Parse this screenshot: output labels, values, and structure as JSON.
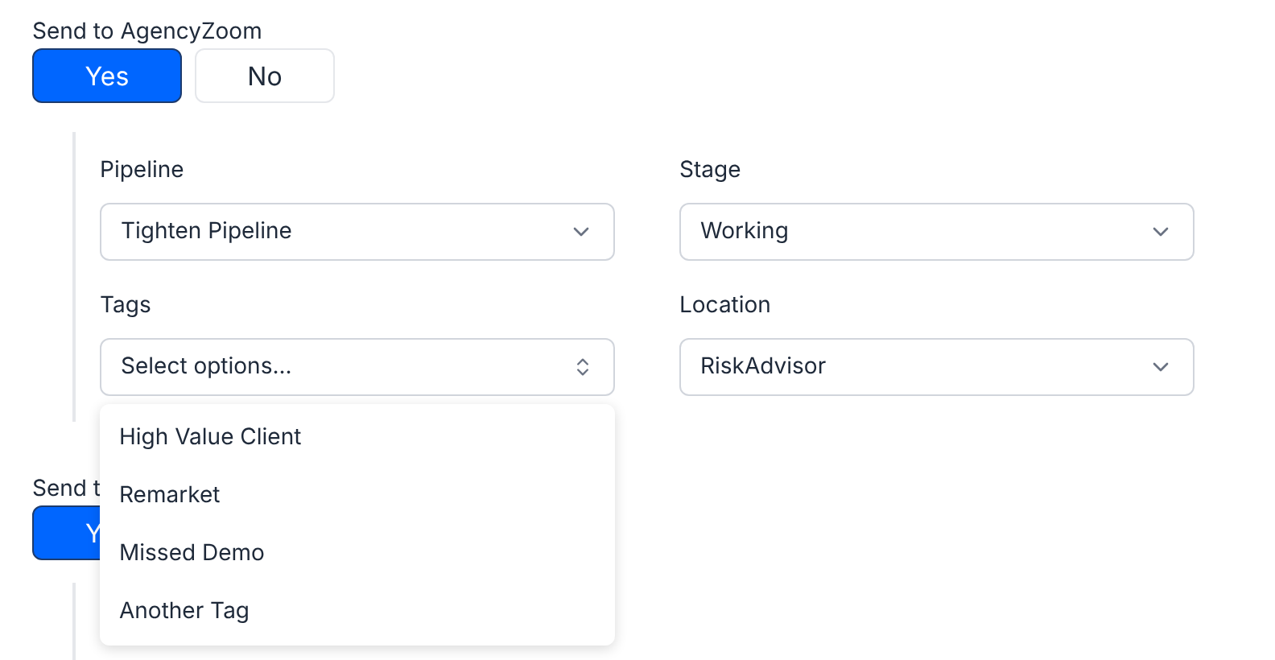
{
  "sections": [
    {
      "label": "Send to AgencyZoom",
      "options": [
        {
          "label": "Yes",
          "selected": true
        },
        {
          "label": "No",
          "selected": false
        }
      ],
      "fields": [
        {
          "kind": "select",
          "label": "Pipeline",
          "value": "Tighten Pipeline"
        },
        {
          "kind": "select",
          "label": "Stage",
          "value": "Working"
        },
        {
          "kind": "multiselect",
          "label": "Tags",
          "placeholder": "Select options...",
          "expanded": true,
          "options": [
            "High Value Client",
            "Remarket",
            "Missed Demo",
            "Another Tag"
          ]
        },
        {
          "kind": "select",
          "label": "Location",
          "value": "RiskAdvisor"
        }
      ]
    },
    {
      "label": "Send t",
      "options": [
        {
          "label": "Y",
          "selected": true
        }
      ]
    }
  ]
}
